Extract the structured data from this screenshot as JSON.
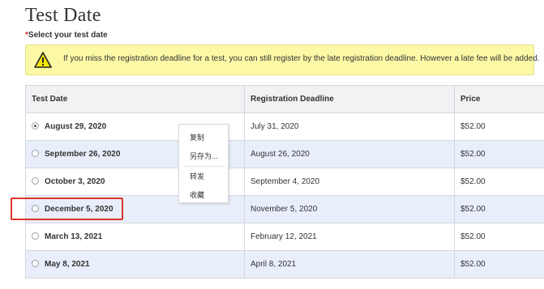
{
  "page": {
    "title": "Test Date",
    "required_marker": "*",
    "subtitle": "Select your test date"
  },
  "warning": {
    "icon": "warning-triangle-icon",
    "text": "If you miss the registration deadline for a test, you can still register by the late registration deadline. However a late fee will be added."
  },
  "table": {
    "headers": [
      "Test Date",
      "Registration Deadline",
      "Price"
    ],
    "rows": [
      {
        "date": "August 29, 2020",
        "deadline": "July 31, 2020",
        "price": "$52.00",
        "selected": true
      },
      {
        "date": "September 26, 2020",
        "deadline": "August 26, 2020",
        "price": "$52.00",
        "selected": false
      },
      {
        "date": "October 3, 2020",
        "deadline": "September 4, 2020",
        "price": "$52.00",
        "selected": false
      },
      {
        "date": "December 5, 2020",
        "deadline": "November 5, 2020",
        "price": "$52.00",
        "selected": false
      },
      {
        "date": "March 13, 2021",
        "deadline": "February 12, 2021",
        "price": "$52.00",
        "selected": false
      },
      {
        "date": "May 8, 2021",
        "deadline": "April 8, 2021",
        "price": "$52.00",
        "selected": false
      }
    ]
  },
  "context_menu": {
    "items": [
      "复制",
      "另存为...",
      "转发",
      "收藏"
    ]
  },
  "colors": {
    "warning_bg": "#fbf9a6",
    "row_alt_bg": "#e9eefb",
    "header_bg": "#f1f2f4",
    "highlight": "#e0352b",
    "required": "#d32f2f"
  }
}
